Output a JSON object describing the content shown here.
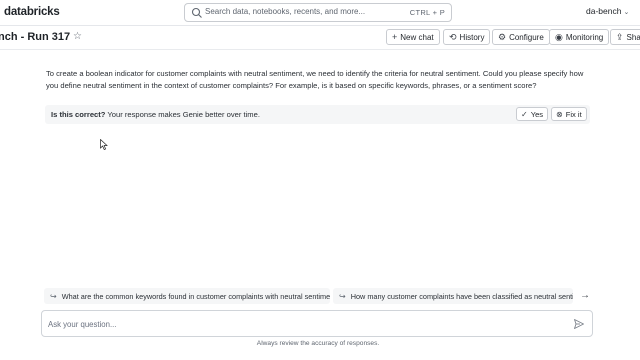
{
  "app": {
    "brand": "databricks"
  },
  "search": {
    "placeholder": "Search data, notebooks, recents, and more...",
    "shortcut": "CTRL + P"
  },
  "user": {
    "name": "da-bench"
  },
  "header": {
    "title": "nch - Run 317",
    "buttons": {
      "new_chat": "New chat",
      "history": "History",
      "configure": "Configure",
      "monitoring": "Monitoring",
      "share": "Sha"
    }
  },
  "message": {
    "text": "To create a boolean indicator for customer complaints with neutral sentiment, we need to identify the criteria for neutral sentiment. Could you please specify how you define neutral sentiment in the context of customer complaints? For example, is it based on specific keywords, phrases, or a sentiment score?"
  },
  "feedback": {
    "question": "Is this correct?",
    "note": " Your response makes Genie better over time.",
    "yes": "Yes",
    "fix": "Fix it"
  },
  "suggestions": [
    "What are the common keywords found in customer complaints with neutral sentiment?",
    "How many customer complaints have been classified as neutral sentiment"
  ],
  "composer": {
    "placeholder": "Ask your question..."
  },
  "footer": {
    "disclaimer": "Always review the accuracy of responses."
  }
}
